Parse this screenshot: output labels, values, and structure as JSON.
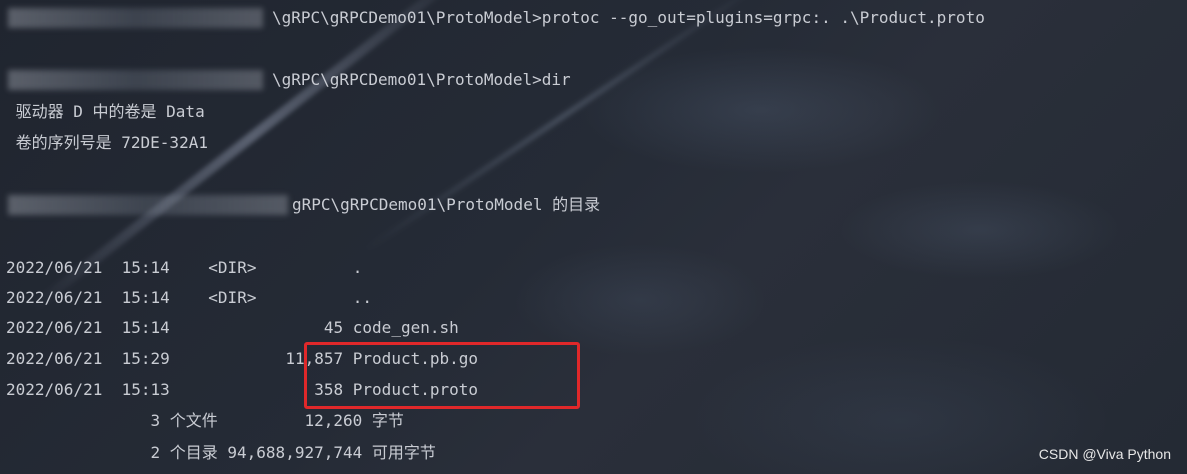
{
  "terminal": {
    "lines": [
      "\\gRPC\\gRPCDemo01\\ProtoModel>protoc --go_out=plugins=grpc:. .\\Product.proto",
      "\\gRPC\\gRPCDemo01\\ProtoModel>dir",
      " 驱动器 D 中的卷是 Data",
      " 卷的序列号是 72DE-32A1",
      "gRPC\\gRPCDemo01\\ProtoModel 的目录",
      "2022/06/21  15:14    <DIR>          .",
      "2022/06/21  15:14    <DIR>          ..",
      "2022/06/21  15:14                45 code_gen.sh",
      "2022/06/21  15:29            11,857 Product.pb.go",
      "2022/06/21  15:13               358 Product.proto",
      "               3 个文件         12,260 字节",
      "               2 个目录 94,688,927,744 可用字节"
    ]
  },
  "watermark": "CSDN @Viva Python"
}
